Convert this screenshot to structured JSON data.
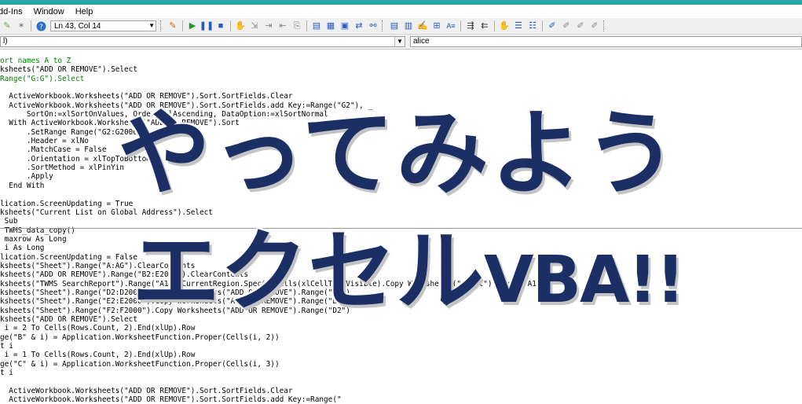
{
  "menu": {
    "items": [
      "dd-Ins",
      "Window",
      "Help"
    ]
  },
  "toolbar": {
    "position_text": "Ln 43, Col 14"
  },
  "combos": {
    "object_value": "l)",
    "procedure_value": "alice"
  },
  "code_lines": [
    {
      "t": "ort names A to Z",
      "c": "cm"
    },
    {
      "t": "ksheets(\"ADD OR REMOVE\").Select",
      "c": ""
    },
    {
      "t": "Range(\"G:G\").Select",
      "c": "cm"
    },
    {
      "t": "",
      "c": ""
    },
    {
      "t": "  ActiveWorkbook.Worksheets(\"ADD OR REMOVE\").Sort.SortFields.Clear",
      "c": ""
    },
    {
      "t": "  ActiveWorkbook.Worksheets(\"ADD OR REMOVE\").Sort.SortFields.add Key:=Range(\"G2\"), _",
      "c": ""
    },
    {
      "t": "      SortOn:=xlSortOnValues, Order:=xlAscending, DataOption:=xlSortNormal",
      "c": ""
    },
    {
      "t": "  With ActiveWorkbook.Worksheets(\"ADD OR REMOVE\").Sort",
      "c": ""
    },
    {
      "t": "      .SetRange Range(\"G2:G2000\")",
      "c": ""
    },
    {
      "t": "      .Header = xlNo",
      "c": ""
    },
    {
      "t": "      .MatchCase = False",
      "c": ""
    },
    {
      "t": "      .Orientation = xlTopToBottom",
      "c": ""
    },
    {
      "t": "      .SortMethod = xlPinYin",
      "c": ""
    },
    {
      "t": "      .Apply",
      "c": ""
    },
    {
      "t": "  End With",
      "c": ""
    },
    {
      "t": "",
      "c": ""
    },
    {
      "t": "lication.ScreenUpdating = True",
      "c": ""
    },
    {
      "t": "ksheets(\"Current List on Global Address\").Select",
      "c": ""
    },
    {
      "t": " Sub",
      "c": ""
    },
    {
      "t": " TWMS_data_copy()",
      "c": ""
    },
    {
      "t": " maxrow As Long",
      "c": ""
    },
    {
      "t": " i As Long",
      "c": ""
    },
    {
      "t": "lication.ScreenUpdating = False",
      "c": ""
    },
    {
      "t": "ksheets(\"Sheet\").Range(\"A:AG\").ClearContents",
      "c": ""
    },
    {
      "t": "ksheets(\"ADD OR REMOVE\").Range(\"B2:E2000\").ClearContents",
      "c": ""
    },
    {
      "t": "ksheets(\"TWMS SearchReport\").Range(\"A1\").CurrentRegion.SpecialCells(xlCellTypeVisible).Copy Worksheets(\"Sheet\").Range(\"A1\")",
      "c": ""
    },
    {
      "t": "ksheets(\"Sheet\").Range(\"D2:D2000\").Copy Worksheets(\"ADD OR REMOVE\").Range(\"B2\")",
      "c": ""
    },
    {
      "t": "ksheets(\"Sheet\").Range(\"E2:E2000\").Copy Worksheets(\"ADD OR REMOVE\").Range(\"E2\")",
      "c": ""
    },
    {
      "t": "ksheets(\"Sheet\").Range(\"F2:F2000\").Copy Worksheets(\"ADD OR REMOVE\").Range(\"D2\")",
      "c": ""
    },
    {
      "t": "ksheets(\"ADD OR REMOVE\").Select",
      "c": ""
    },
    {
      "t": " i = 2 To Cells(Rows.Count, 2).End(xlUp).Row",
      "c": ""
    },
    {
      "t": "ge(\"B\" & i) = Application.WorksheetFunction.Proper(Cells(i, 2))",
      "c": ""
    },
    {
      "t": "t i",
      "c": ""
    },
    {
      "t": " i = 1 To Cells(Rows.Count, 2).End(xlUp).Row",
      "c": ""
    },
    {
      "t": "ge(\"C\" & i) = Application.WorksheetFunction.Proper(Cells(i, 3))",
      "c": ""
    },
    {
      "t": "t i",
      "c": ""
    },
    {
      "t": "",
      "c": ""
    },
    {
      "t": "  ActiveWorkbook.Worksheets(\"ADD OR REMOVE\").Sort.SortFields.Clear",
      "c": ""
    },
    {
      "t": "  ActiveWorkbook.Worksheets(\"ADD OR REMOVE\").Sort.SortFields.add Key:=Range(\"",
      "c": ""
    }
  ],
  "overlay": {
    "line1": "やってみよう",
    "line2_kana": "エクセル",
    "line2_latin": "VBA!!"
  },
  "colors": {
    "accent": "#2aa6a6",
    "overlay_text": "#1b2f64",
    "comment": "#008000",
    "keyword": "#0000c8"
  }
}
